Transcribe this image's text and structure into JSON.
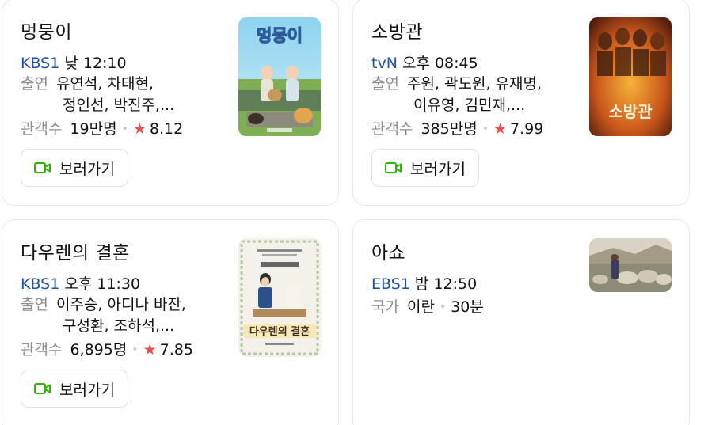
{
  "cards": [
    {
      "title": "멍뭉이",
      "channel": "KBS1",
      "time": "낮 12:10",
      "cast_label": "출연",
      "cast_line1": "유연석, 차태현,",
      "cast_line2": "정인선, 박진주,...",
      "audience_label": "관객수",
      "audience": "19만명",
      "rating": "8.12",
      "watch_label": "보러가기",
      "poster_text": "멍뭉이"
    },
    {
      "title": "소방관",
      "channel": "tvN",
      "time": "오후 08:45",
      "cast_label": "출연",
      "cast_line1": "주원, 곽도원, 유재명,",
      "cast_line2": "이유영, 김민재,...",
      "audience_label": "관객수",
      "audience": "385만명",
      "rating": "7.99",
      "watch_label": "보러가기",
      "poster_text": "소방관"
    },
    {
      "title": "다우렌의 결혼",
      "channel": "KBS1",
      "time": "오후 11:30",
      "cast_label": "출연",
      "cast_line1": "이주승, 아디나 바잔,",
      "cast_line2": "구성환, 조하석,...",
      "audience_label": "관객수",
      "audience": "6,895명",
      "rating": "7.85",
      "watch_label": "보러가기",
      "poster_text": "다우렌의 결혼"
    },
    {
      "title": "아쇼",
      "channel": "EBS1",
      "time": "밤 12:50",
      "country_label": "국가",
      "country": "이란",
      "duration": "30분"
    }
  ],
  "colors": {
    "channel": "#1d4fa3",
    "star": "#e8504f",
    "video_icon": "#2db400"
  },
  "icons": {
    "star": "★",
    "watch": "video-camera-icon"
  }
}
